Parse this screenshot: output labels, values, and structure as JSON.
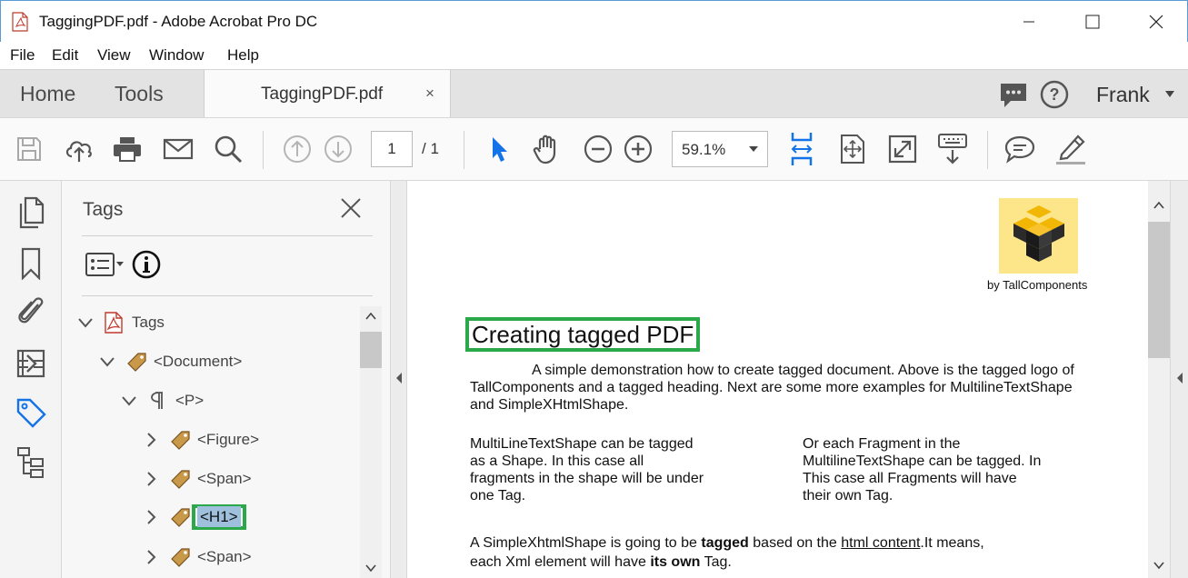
{
  "window": {
    "title": "TaggingPDF.pdf - Adobe Acrobat Pro DC"
  },
  "menu": [
    "File",
    "Edit",
    "View",
    "Window",
    "Help"
  ],
  "tabs": {
    "home": "Home",
    "tools": "Tools",
    "document": "TaggingPDF.pdf",
    "close": "×"
  },
  "user": {
    "name": "Frank"
  },
  "toolbar": {
    "page_current": "1",
    "page_total": "/ 1",
    "zoom": "59.1%"
  },
  "tags_panel": {
    "title": "Tags",
    "tree": [
      {
        "label": "Tags",
        "expanded": true,
        "icon": "pdf-icon"
      },
      {
        "label": "<Document>",
        "expanded": true,
        "icon": "tag-icon"
      },
      {
        "label": "<P>",
        "expanded": true,
        "icon": "paragraph-icon"
      },
      {
        "label": "<Figure>",
        "expanded": false,
        "icon": "tag-icon"
      },
      {
        "label": "<Span>",
        "expanded": false,
        "icon": "tag-icon"
      },
      {
        "label": "<H1>",
        "expanded": false,
        "icon": "tag-icon",
        "selected": true
      },
      {
        "label": "<Span>",
        "expanded": false,
        "icon": "tag-icon"
      }
    ]
  },
  "document": {
    "logo_caption": "by TallComponents",
    "heading": "Creating tagged PDF",
    "intro_1": "A simple demonstration how to create tagged document. Above is the tagged logo of",
    "intro_2": "TallComponents and a tagged heading. Next are some more examples for MultilineTextShape",
    "intro_3": "and SimpleXHtmlShape.",
    "col1": [
      "MultiLineTextShape can be tagged",
      "as a Shape. In this case all",
      "fragments in the shape will be under",
      "one Tag."
    ],
    "col2": [
      "Or each Fragment in the",
      "MultilineTextShape can be tagged. In",
      "This case all Fragments will have",
      "their own Tag."
    ],
    "xhtml_1_a": "A SimpleXhtmlShape is going to be ",
    "xhtml_1_b": "tagged",
    "xhtml_1_c": " based on the ",
    "xhtml_1_d": "html content",
    "xhtml_1_e": ".It means,",
    "xhtml_2_a": "each Xml element will have ",
    "xhtml_2_b": "its own",
    "xhtml_2_c": " Tag."
  },
  "colors": {
    "highlight_green": "#2aa84a",
    "accent_blue": "#1473e6",
    "tag_brown": "#b8863b"
  }
}
